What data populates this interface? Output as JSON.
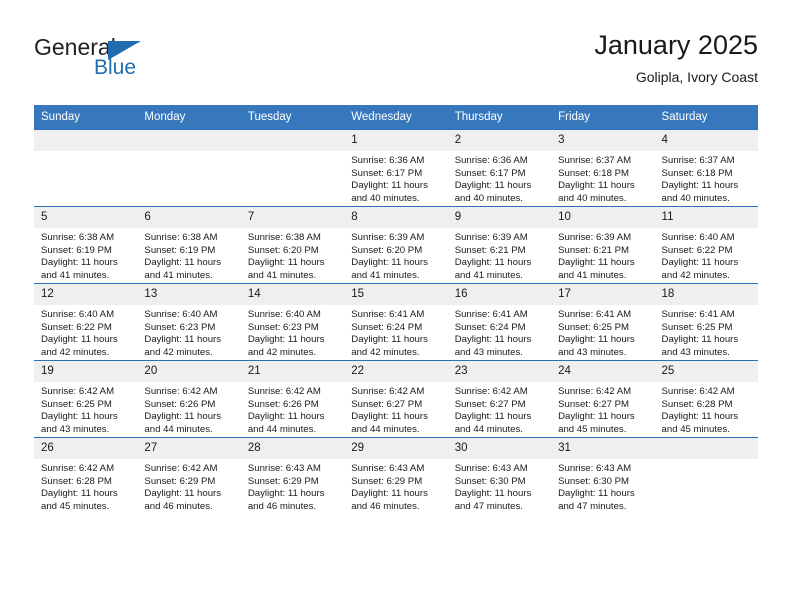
{
  "brand": {
    "name_dark": "General",
    "name_blue": "Blue",
    "triangle_icon": "brand-triangle-icon",
    "accent_color": "#1f6cb0"
  },
  "header": {
    "title": "January 2025",
    "subtitle": "Golipla, Ivory Coast"
  },
  "theme": {
    "header_bg": "#3778bd",
    "row_divider": "#2f6fb5",
    "daynum_bg": "#efefef",
    "text": "#1a1a1a"
  },
  "calendar": {
    "weekday_headers": [
      "Sunday",
      "Monday",
      "Tuesday",
      "Wednesday",
      "Thursday",
      "Friday",
      "Saturday"
    ],
    "labels": {
      "sunrise_prefix": "Sunrise: ",
      "sunset_prefix": "Sunset: ",
      "daylight_prefix": "Daylight: "
    },
    "weeks": [
      [
        {
          "day": "",
          "blank": true
        },
        {
          "day": "",
          "blank": true
        },
        {
          "day": "",
          "blank": true
        },
        {
          "day": "1",
          "sunrise": "Sunrise: 6:36 AM",
          "sunset": "Sunset: 6:17 PM",
          "daylight": "Daylight: 11 hours and 40 minutes."
        },
        {
          "day": "2",
          "sunrise": "Sunrise: 6:36 AM",
          "sunset": "Sunset: 6:17 PM",
          "daylight": "Daylight: 11 hours and 40 minutes."
        },
        {
          "day": "3",
          "sunrise": "Sunrise: 6:37 AM",
          "sunset": "Sunset: 6:18 PM",
          "daylight": "Daylight: 11 hours and 40 minutes."
        },
        {
          "day": "4",
          "sunrise": "Sunrise: 6:37 AM",
          "sunset": "Sunset: 6:18 PM",
          "daylight": "Daylight: 11 hours and 40 minutes."
        }
      ],
      [
        {
          "day": "5",
          "sunrise": "Sunrise: 6:38 AM",
          "sunset": "Sunset: 6:19 PM",
          "daylight": "Daylight: 11 hours and 41 minutes."
        },
        {
          "day": "6",
          "sunrise": "Sunrise: 6:38 AM",
          "sunset": "Sunset: 6:19 PM",
          "daylight": "Daylight: 11 hours and 41 minutes."
        },
        {
          "day": "7",
          "sunrise": "Sunrise: 6:38 AM",
          "sunset": "Sunset: 6:20 PM",
          "daylight": "Daylight: 11 hours and 41 minutes."
        },
        {
          "day": "8",
          "sunrise": "Sunrise: 6:39 AM",
          "sunset": "Sunset: 6:20 PM",
          "daylight": "Daylight: 11 hours and 41 minutes."
        },
        {
          "day": "9",
          "sunrise": "Sunrise: 6:39 AM",
          "sunset": "Sunset: 6:21 PM",
          "daylight": "Daylight: 11 hours and 41 minutes."
        },
        {
          "day": "10",
          "sunrise": "Sunrise: 6:39 AM",
          "sunset": "Sunset: 6:21 PM",
          "daylight": "Daylight: 11 hours and 41 minutes."
        },
        {
          "day": "11",
          "sunrise": "Sunrise: 6:40 AM",
          "sunset": "Sunset: 6:22 PM",
          "daylight": "Daylight: 11 hours and 42 minutes."
        }
      ],
      [
        {
          "day": "12",
          "sunrise": "Sunrise: 6:40 AM",
          "sunset": "Sunset: 6:22 PM",
          "daylight": "Daylight: 11 hours and 42 minutes."
        },
        {
          "day": "13",
          "sunrise": "Sunrise: 6:40 AM",
          "sunset": "Sunset: 6:23 PM",
          "daylight": "Daylight: 11 hours and 42 minutes."
        },
        {
          "day": "14",
          "sunrise": "Sunrise: 6:40 AM",
          "sunset": "Sunset: 6:23 PM",
          "daylight": "Daylight: 11 hours and 42 minutes."
        },
        {
          "day": "15",
          "sunrise": "Sunrise: 6:41 AM",
          "sunset": "Sunset: 6:24 PM",
          "daylight": "Daylight: 11 hours and 42 minutes."
        },
        {
          "day": "16",
          "sunrise": "Sunrise: 6:41 AM",
          "sunset": "Sunset: 6:24 PM",
          "daylight": "Daylight: 11 hours and 43 minutes."
        },
        {
          "day": "17",
          "sunrise": "Sunrise: 6:41 AM",
          "sunset": "Sunset: 6:25 PM",
          "daylight": "Daylight: 11 hours and 43 minutes."
        },
        {
          "day": "18",
          "sunrise": "Sunrise: 6:41 AM",
          "sunset": "Sunset: 6:25 PM",
          "daylight": "Daylight: 11 hours and 43 minutes."
        }
      ],
      [
        {
          "day": "19",
          "sunrise": "Sunrise: 6:42 AM",
          "sunset": "Sunset: 6:25 PM",
          "daylight": "Daylight: 11 hours and 43 minutes."
        },
        {
          "day": "20",
          "sunrise": "Sunrise: 6:42 AM",
          "sunset": "Sunset: 6:26 PM",
          "daylight": "Daylight: 11 hours and 44 minutes."
        },
        {
          "day": "21",
          "sunrise": "Sunrise: 6:42 AM",
          "sunset": "Sunset: 6:26 PM",
          "daylight": "Daylight: 11 hours and 44 minutes."
        },
        {
          "day": "22",
          "sunrise": "Sunrise: 6:42 AM",
          "sunset": "Sunset: 6:27 PM",
          "daylight": "Daylight: 11 hours and 44 minutes."
        },
        {
          "day": "23",
          "sunrise": "Sunrise: 6:42 AM",
          "sunset": "Sunset: 6:27 PM",
          "daylight": "Daylight: 11 hours and 44 minutes."
        },
        {
          "day": "24",
          "sunrise": "Sunrise: 6:42 AM",
          "sunset": "Sunset: 6:27 PM",
          "daylight": "Daylight: 11 hours and 45 minutes."
        },
        {
          "day": "25",
          "sunrise": "Sunrise: 6:42 AM",
          "sunset": "Sunset: 6:28 PM",
          "daylight": "Daylight: 11 hours and 45 minutes."
        }
      ],
      [
        {
          "day": "26",
          "sunrise": "Sunrise: 6:42 AM",
          "sunset": "Sunset: 6:28 PM",
          "daylight": "Daylight: 11 hours and 45 minutes."
        },
        {
          "day": "27",
          "sunrise": "Sunrise: 6:42 AM",
          "sunset": "Sunset: 6:29 PM",
          "daylight": "Daylight: 11 hours and 46 minutes."
        },
        {
          "day": "28",
          "sunrise": "Sunrise: 6:43 AM",
          "sunset": "Sunset: 6:29 PM",
          "daylight": "Daylight: 11 hours and 46 minutes."
        },
        {
          "day": "29",
          "sunrise": "Sunrise: 6:43 AM",
          "sunset": "Sunset: 6:29 PM",
          "daylight": "Daylight: 11 hours and 46 minutes."
        },
        {
          "day": "30",
          "sunrise": "Sunrise: 6:43 AM",
          "sunset": "Sunset: 6:30 PM",
          "daylight": "Daylight: 11 hours and 47 minutes."
        },
        {
          "day": "31",
          "sunrise": "Sunrise: 6:43 AM",
          "sunset": "Sunset: 6:30 PM",
          "daylight": "Daylight: 11 hours and 47 minutes."
        },
        {
          "day": "",
          "blank": true
        }
      ]
    ]
  }
}
